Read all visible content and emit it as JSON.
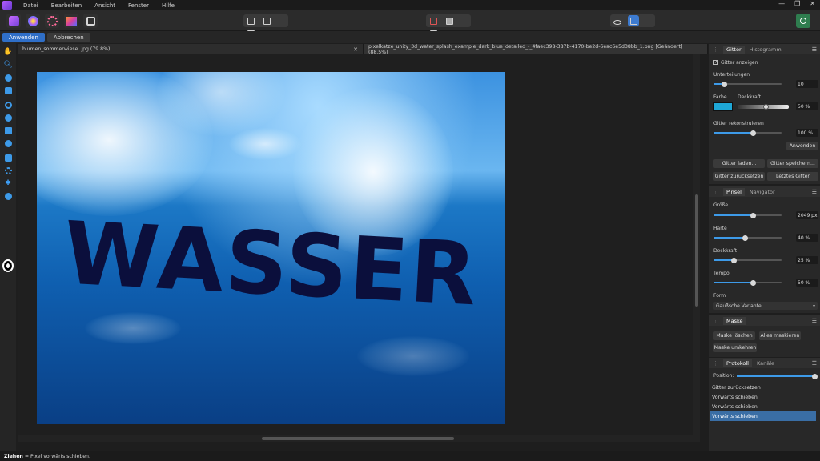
{
  "menu": [
    "Datei",
    "Bearbeiten",
    "Ansicht",
    "Fenster",
    "Hilfe"
  ],
  "window_controls": [
    "—",
    "❐",
    "✕"
  ],
  "context": {
    "apply": "Anwenden",
    "cancel": "Abbrechen"
  },
  "documents": [
    {
      "title": "blumen_sommerwiese .jpg (79.8%)"
    },
    {
      "title": "pixelkatze_unity_3d_water_splash_example_dark_blue_detailed_-_4faec398-387b-4170-be2d-6eac6e5d38bb_1.png [Geändert] (88.5%)"
    }
  ],
  "artwork": {
    "text": "WASSER"
  },
  "grid_panel": {
    "tabs": [
      "Gitter",
      "Histogramm"
    ],
    "show_grid": "Gitter anzeigen",
    "subdivisions_label": "Unterteilungen",
    "subdivisions_value": "10",
    "color_label": "Farbe",
    "opacity_label": "Deckkraft",
    "opacity_value": "50 %",
    "color": "#1ea7d6",
    "rebuild_label": "Gitter rekonstruieren",
    "rebuild_value": "100 %",
    "apply": "Anwenden",
    "load": "Gitter laden...",
    "save": "Gitter speichern...",
    "reset": "Gitter zurücksetzen",
    "last": "Letztes Gitter"
  },
  "brush_panel": {
    "tabs": [
      "Pinsel",
      "Navigator"
    ],
    "size_label": "Größe",
    "size_value": "2049 px",
    "hardness_label": "Härte",
    "hardness_value": "40 %",
    "opacity_label": "Deckkraft",
    "opacity_value": "25 %",
    "speed_label": "Tempo",
    "speed_value": "50 %",
    "shape_label": "Form",
    "shape_value": "Gaußsche Variante"
  },
  "mask_panel": {
    "title": "Maske",
    "clear": "Maske löschen",
    "mask_all": "Alles maskieren",
    "invert": "Maske umkehren"
  },
  "history_panel": {
    "tabs": [
      "Protokoll",
      "Kanäle"
    ],
    "position_label": "Position:",
    "items": [
      "Gitter zurücksetzen",
      "Vorwärts schieben",
      "Vorwärts schieben",
      "Vorwärts schieben"
    ],
    "selected_index": 3
  },
  "status": {
    "tool": "Ziehen",
    "hint": "= Pixel vorwärts schieben."
  }
}
